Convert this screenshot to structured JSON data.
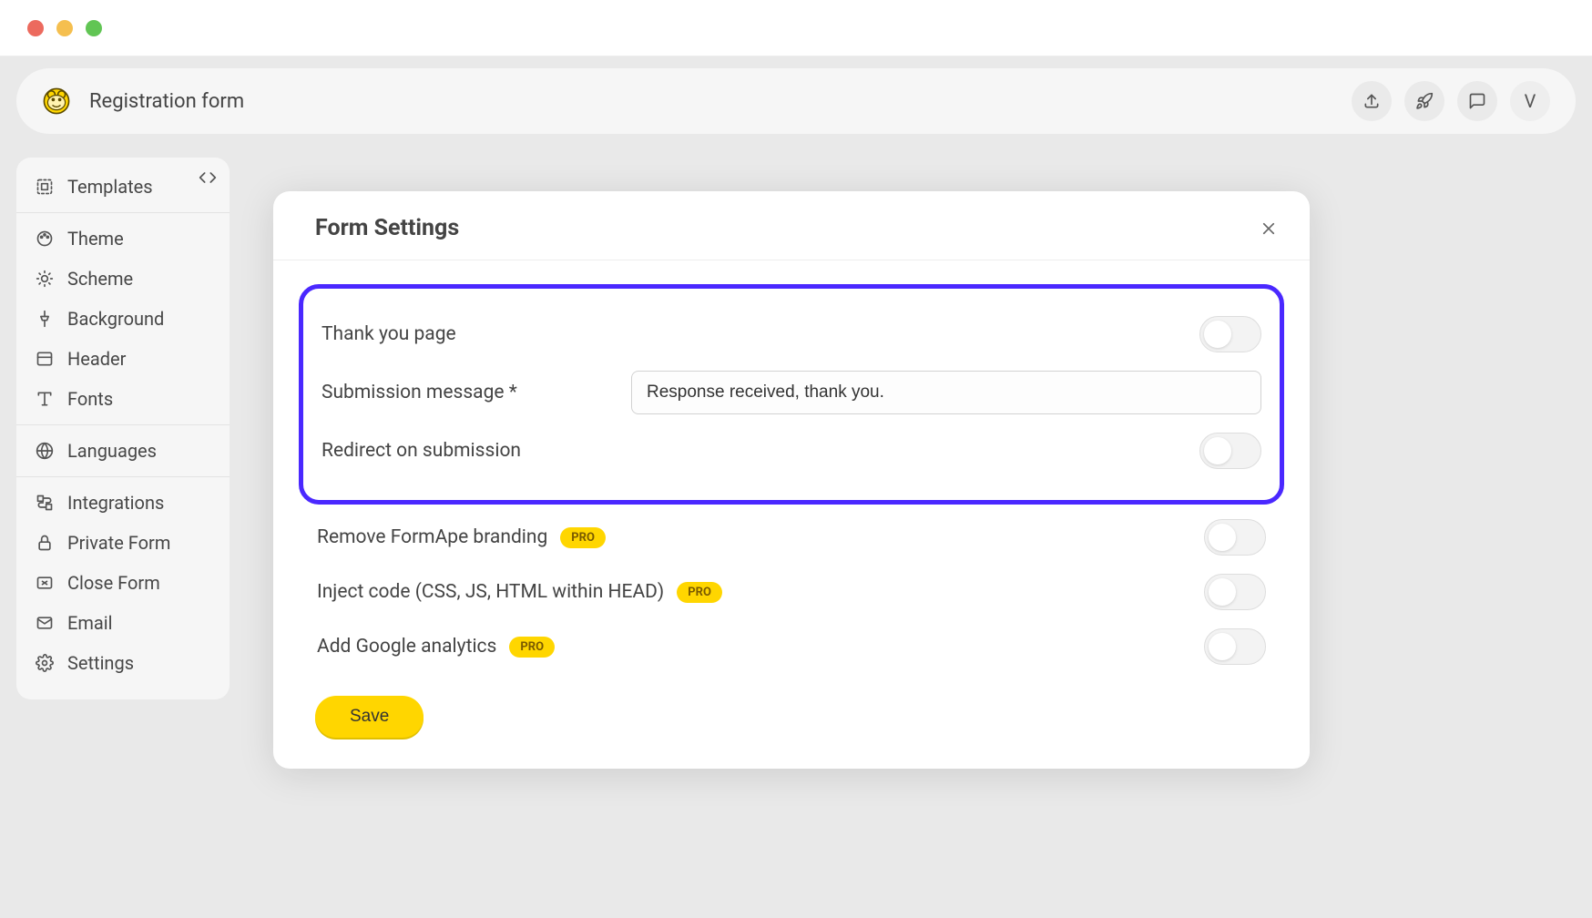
{
  "header": {
    "title": "Registration form",
    "avatar_initial": "V"
  },
  "sidebar": {
    "groups": [
      {
        "items": [
          {
            "icon": "templates",
            "label": "Templates"
          }
        ]
      },
      {
        "items": [
          {
            "icon": "theme",
            "label": "Theme"
          },
          {
            "icon": "scheme",
            "label": "Scheme"
          },
          {
            "icon": "background",
            "label": "Background"
          },
          {
            "icon": "header",
            "label": "Header"
          },
          {
            "icon": "fonts",
            "label": "Fonts"
          }
        ]
      },
      {
        "items": [
          {
            "icon": "languages",
            "label": "Languages"
          }
        ]
      },
      {
        "items": [
          {
            "icon": "integrations",
            "label": "Integrations"
          },
          {
            "icon": "private",
            "label": "Private Form"
          },
          {
            "icon": "close",
            "label": "Close Form"
          },
          {
            "icon": "email",
            "label": "Email"
          },
          {
            "icon": "settings",
            "label": "Settings"
          }
        ]
      }
    ]
  },
  "modal": {
    "title": "Form Settings",
    "rows": {
      "thank_you": {
        "label": "Thank you page",
        "toggle": false
      },
      "submission_msg": {
        "label": "Submission message *",
        "value": "Response received, thank you."
      },
      "redirect": {
        "label": "Redirect on submission",
        "toggle": false
      },
      "remove_branding": {
        "label": "Remove FormApe branding",
        "pro": "PRO",
        "toggle": false
      },
      "inject_code": {
        "label": "Inject code (CSS, JS, HTML within HEAD)",
        "pro": "PRO",
        "toggle": false
      },
      "google_analytics": {
        "label": "Add Google analytics",
        "pro": "PRO",
        "toggle": false
      }
    },
    "save_label": "Save"
  }
}
